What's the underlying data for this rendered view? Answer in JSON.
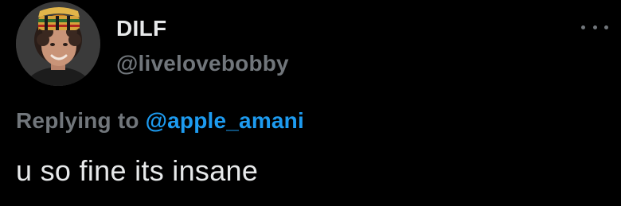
{
  "author": {
    "display_name": "DILF",
    "handle": "@livelovebobby",
    "avatar": "avatar-photo-patterned-hat"
  },
  "menu": {
    "icon": "more-horizontal-icon"
  },
  "reply_context": {
    "prefix": "Replying to",
    "mention": "@apple_amani"
  },
  "tweet": {
    "text": "u so fine its insane"
  },
  "colors": {
    "background": "#000000",
    "primary_text": "#e7e9ea",
    "secondary_text": "#71767b",
    "mention": "#1d9bf0"
  }
}
